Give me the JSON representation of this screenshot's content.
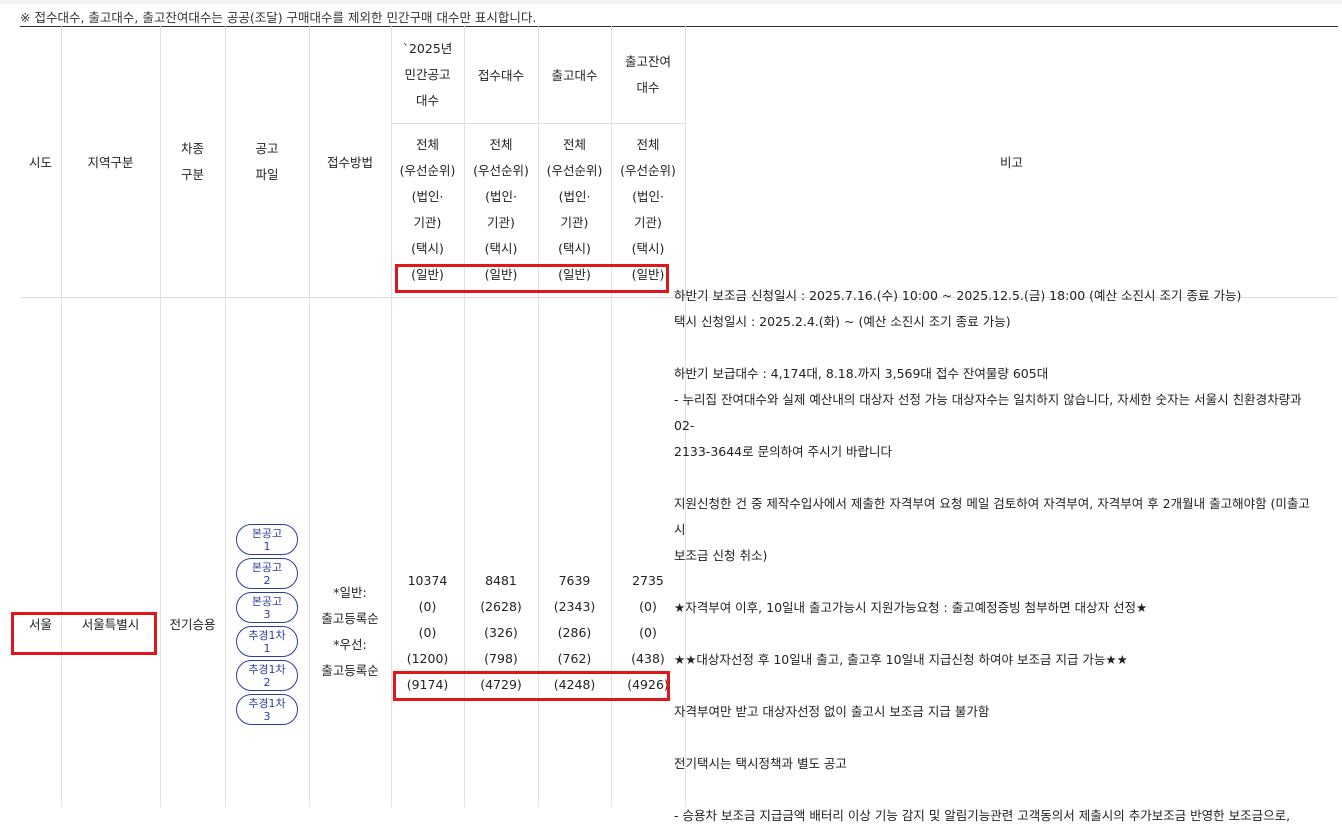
{
  "notice": "※ 접수대수, 출고대수, 출고잔여대수는 공공(조달) 구매대수를 제외한 민간구매 대수만 표시합니다.",
  "header": {
    "sido": "시도",
    "region": "지역구분",
    "car_type": [
      "차종",
      "구분"
    ],
    "notice_file": [
      "공고",
      "파일"
    ],
    "method": "접수방법",
    "budget": [
      "`2025년",
      "민간공고",
      "대수"
    ],
    "received": "접수대수",
    "released": "출고대수",
    "remaining": [
      "출고잔여",
      "대수"
    ],
    "sub_labels": [
      "전체",
      "(우선순위)",
      "(법인·",
      "기관)",
      "(택시)",
      "(일반)"
    ],
    "remarks": "비고"
  },
  "row": {
    "sido": "서울",
    "region": "서울특별시",
    "car_type": "전기승용",
    "notice_buttons": [
      {
        "line1": "본공고",
        "line2": "1"
      },
      {
        "line1": "본공고",
        "line2": "2"
      },
      {
        "line1": "본공고",
        "line2": "3"
      },
      {
        "line1": "추경1차",
        "line2": "1"
      },
      {
        "line1": "추경1차",
        "line2": "2"
      },
      {
        "line1": "추경1차",
        "line2": "3"
      }
    ],
    "method": [
      "*일반:",
      "출고등록순",
      "*우선:",
      "출고등록순"
    ],
    "budget": [
      "10374",
      "(0)",
      "(0)",
      "(1200)",
      "(9174)"
    ],
    "received": [
      "8481",
      "(2628)",
      "(326)",
      "(798)",
      "(4729)"
    ],
    "released": [
      "7639",
      "(2343)",
      "(286)",
      "(762)",
      "(4248)"
    ],
    "remaining": [
      "2735",
      "(0)",
      "(0)",
      "(438)",
      "(4926)"
    ],
    "remarks": [
      "하반기 보조금 신청일시 : 2025.7.16.(수) 10:00 ~ 2025.12.5.(금) 18:00 (예산 소진시 조기 종료 가능)",
      "택시 신청일시 : 2025.2.4.(화) ~ (예산 소진시 조기 종료 가능)",
      "",
      "하반기 보급대수 : 4,174대, 8.18.까지 3,569대 접수 잔여물량 605대",
      "- 누리집 잔여대수와 실제 예산내의 대상자 선정 가능 대상자수는 일치하지 않습니다, 자세한 숫자는 서울시 친환경차량과 02-",
      "2133-3644로 문의하여 주시기 바랍니다",
      "",
      "지원신청한 건 중 제작수입사에서 제출한 자격부여 요청 메일 검토하여 자격부여, 자격부여 후 2개월내 출고해야함 (미출고시",
      "보조금 신청 취소)",
      "",
      "★자격부여 이후, 10일내 출고가능시 지원가능요청 : 출고예정증빙 첨부하면 대상자 선정★",
      "",
      "★★대상자선정 후 10일내 출고, 출고후 10일내 지급신청 하여야 보조금 지급 가능★★",
      "",
      "자격부여만 받고 대상자선정 없이 출고시 보조금 지급 불가함",
      "",
      "전기택시는 택시정책과 별도 공고",
      "",
      "- 승용차 보조금 지급금액 배터리 이상 기능 감지 및 알림기능관련 고객동의서 제출시의 추가보조금 반영한 보조금으로,"
    ]
  },
  "colors": {
    "highlight": "#e0161b",
    "button": "#2c3e9a"
  }
}
